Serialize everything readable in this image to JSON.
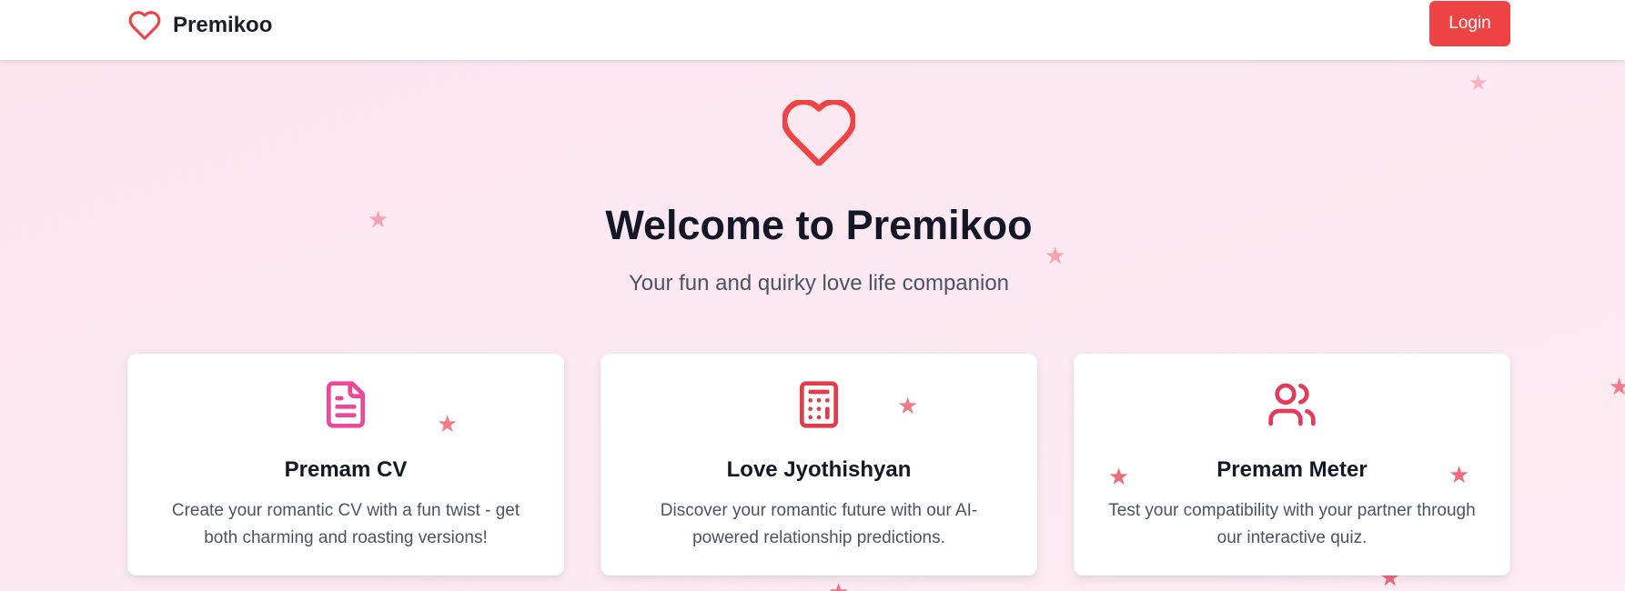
{
  "navbar": {
    "brand_icon": "heart-outline-icon",
    "brand_name": "Premikoo",
    "login_label": "Login"
  },
  "hero": {
    "icon": "heart-outline-icon",
    "title": "Welcome to Premikoo",
    "subtitle": "Your fun and quirky love life companion"
  },
  "features": [
    {
      "icon": "document-icon",
      "title": "Premam CV",
      "description": "Create your romantic CV with a fun twist - get both charming and roasting versions!",
      "icon_color": "#ec4899"
    },
    {
      "icon": "calculator-icon",
      "title": "Love Jyothishyan",
      "description": "Discover your romantic future with our AI-powered relationship predictions.",
      "icon_color": "#e23c4a"
    },
    {
      "icon": "users-icon",
      "title": "Premam Meter",
      "description": "Test your compatibility with your partner through our interactive quiz.",
      "icon_color": "#e23c5a"
    }
  ],
  "colors": {
    "accent": "#ef4444",
    "background": "#fce7f0",
    "star": "#f27b8a",
    "heading": "#141826",
    "body_text": "#4b5364"
  }
}
